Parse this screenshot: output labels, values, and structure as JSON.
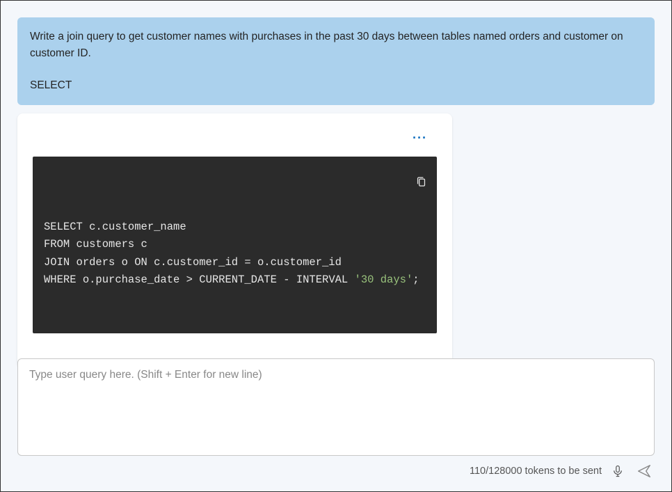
{
  "user_message": {
    "prompt": "Write a join query to get customer names with purchases in the past 30 days between tables named orders and customer on customer ID.",
    "suffix": "SELECT"
  },
  "assistant_response": {
    "more_label": "···",
    "code_lines": [
      [
        {
          "t": "keyword",
          "v": "SELECT"
        },
        {
          "t": "plain",
          "v": " c.customer_name"
        }
      ],
      [
        {
          "t": "keyword",
          "v": "FROM"
        },
        {
          "t": "plain",
          "v": " customers c"
        }
      ],
      [
        {
          "t": "keyword",
          "v": "JOIN"
        },
        {
          "t": "plain",
          "v": " orders o "
        },
        {
          "t": "keyword",
          "v": "ON"
        },
        {
          "t": "plain",
          "v": " c.customer_id "
        },
        {
          "t": "op",
          "v": "="
        },
        {
          "t": "plain",
          "v": " o.customer_id"
        }
      ],
      [
        {
          "t": "keyword",
          "v": "WHERE"
        },
        {
          "t": "plain",
          "v": " o.purchase_date "
        },
        {
          "t": "op",
          "v": ">"
        },
        {
          "t": "plain",
          "v": " CURRENT_DATE "
        },
        {
          "t": "op",
          "v": "-"
        },
        {
          "t": "plain",
          "v": " INTERVAL "
        },
        {
          "t": "string",
          "v": "'30 days'"
        },
        {
          "t": "plain",
          "v": ";"
        }
      ]
    ]
  },
  "input": {
    "placeholder": "Type user query here. (Shift + Enter for new line)"
  },
  "footer": {
    "token_status": "110/128000 tokens to be sent"
  },
  "icons": {
    "copy": "copy-icon",
    "mic": "microphone-icon",
    "send": "send-icon",
    "more": "more-icon"
  }
}
